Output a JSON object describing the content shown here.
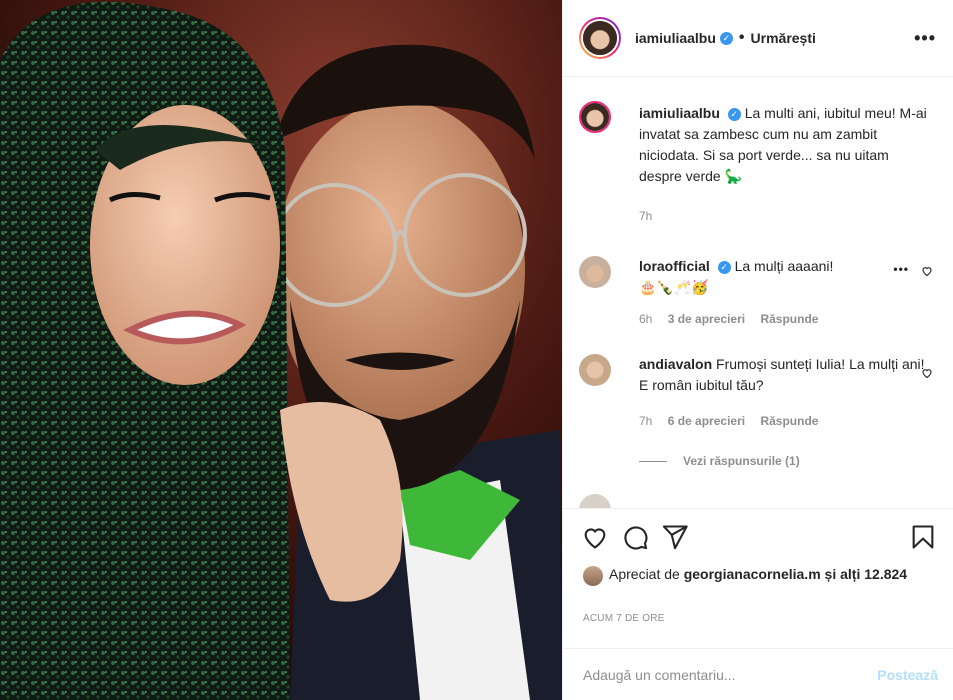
{
  "post": {
    "image_alt": "Selfie of a woman with a sequined green head scarf and a bearded man with round glasses"
  },
  "header": {
    "username": "iamiuliaalbu",
    "separator": "•",
    "follow_label": "Urmărești",
    "more_label": "•••"
  },
  "caption": {
    "username": "iamiuliaalbu",
    "text": "La multi ani, iubitul meu! M-ai invatat sa zambesc cum nu am zambit niciodata. Si sa port verde... sa nu uitam despre verde 🦕",
    "time": "7h"
  },
  "comments": [
    {
      "username": "loraofficial",
      "verified": true,
      "text": "La mulți aaaani!",
      "emoji_line": "🎂🍾🥂🥳",
      "time": "6h",
      "likes": "3 de aprecieri",
      "reply": "Răspunde"
    },
    {
      "username": "andiavalon",
      "verified": false,
      "text": "Frumoși sunteți Iulia! La mulți ani! E român iubitul tău?",
      "time": "7h",
      "likes": "6 de aprecieri",
      "reply": "Răspunde"
    }
  ],
  "replies_toggle": "Vezi răspunsurile (1)",
  "actions": {
    "icons": [
      "heart-icon",
      "comment-icon",
      "share-icon",
      "bookmark-icon"
    ]
  },
  "likes": {
    "prefix": "Apreciat de",
    "user": "georgianacornelia.m",
    "and": "și",
    "others": "alți 12.824"
  },
  "timestamp": "ACUM 7 DE ORE",
  "add_comment": {
    "placeholder": "Adaugă un comentariu...",
    "post_label": "Postează"
  },
  "colors": {
    "verified": "#3897f0",
    "muted": "#8e8e8e",
    "post_disabled": "#b2dffc"
  }
}
